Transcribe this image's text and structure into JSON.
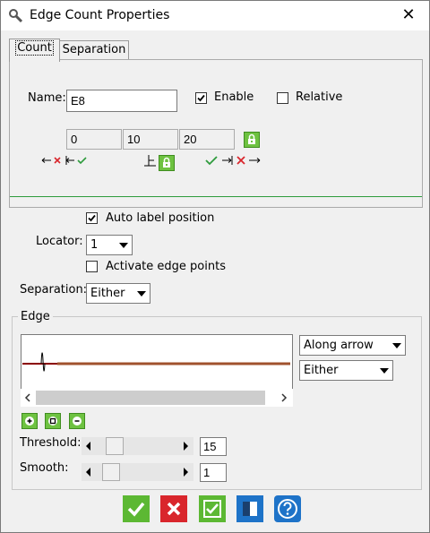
{
  "window": {
    "title": "Edge Count Properties",
    "close_glyph": "✕"
  },
  "tabs": [
    {
      "label": "Count",
      "active": true
    },
    {
      "label": "Separation",
      "active": false
    }
  ],
  "count_tab": {
    "name_label": "Name:",
    "name_value": "E8",
    "enable_label": "Enable",
    "enable_checked": true,
    "relative_label": "Relative",
    "relative_checked": false,
    "values": [
      "0",
      "10",
      "20"
    ]
  },
  "options": {
    "auto_label_text": "Auto label position",
    "auto_label_checked": true,
    "locator_label": "Locator:",
    "locator_value": "1",
    "activate_edge_points_text": "Activate edge points",
    "activate_edge_points_checked": false,
    "separation_label": "Separation:",
    "separation_value": "Either"
  },
  "edge": {
    "group_label": "Edge",
    "direction_value": "Along arrow",
    "polarity_value": "Either",
    "threshold_label": "Threshold:",
    "threshold_value": "15",
    "threshold_level": 0.15,
    "smooth_label": "Smooth:",
    "smooth_value": "1",
    "smooth_level": 0.1
  },
  "colors": {
    "green": "#2d9b3c",
    "red": "#d9262c",
    "brown": "#a0522d",
    "blue": "#1e73c8"
  },
  "footer": [
    "ok-icon",
    "cancel-icon",
    "apply-icon",
    "layout-icon",
    "help-icon"
  ]
}
